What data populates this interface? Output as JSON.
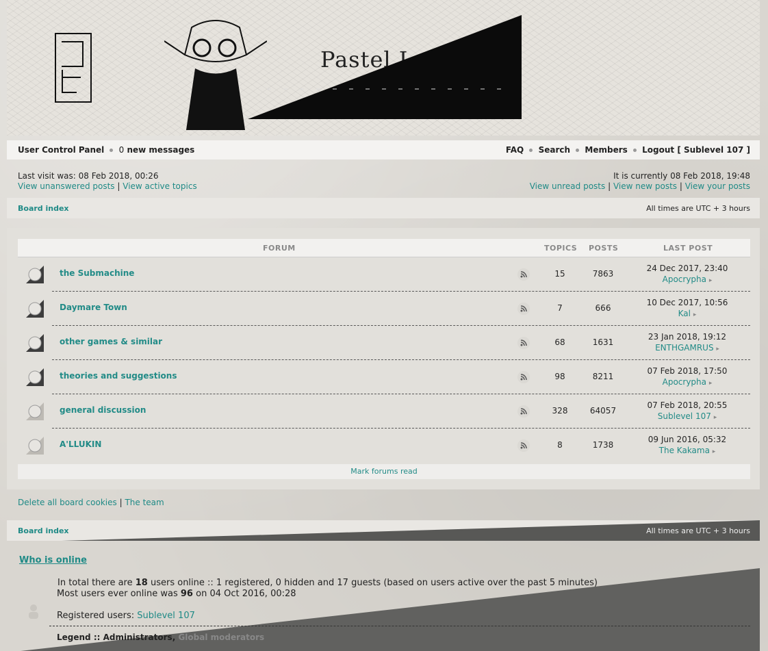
{
  "header": {
    "site_title": "Pastel Land F"
  },
  "navbar": {
    "ucp": "User Control Panel",
    "msg_count": "0",
    "new_messages": "new messages",
    "faq": "FAQ",
    "search": "Search",
    "members": "Members",
    "logout": "Logout [ Sublevel 107 ]"
  },
  "info": {
    "last_visit": "Last visit was: 08 Feb 2018, 00:26",
    "current_time": "It is currently 08 Feb 2018, 19:48",
    "view_unanswered": "View unanswered posts",
    "view_active": "View active topics",
    "view_unread": "View unread posts",
    "view_new": "View new posts",
    "view_your": "View your posts",
    "sep": "|"
  },
  "breadcrumb": {
    "board_index": "Board index",
    "timezone": "All times are UTC + 3 hours"
  },
  "forum_table": {
    "col_forum": "FORUM",
    "col_topics": "TOPICS",
    "col_posts": "POSTS",
    "col_last_post": "LAST POST",
    "rows": [
      {
        "name": "the Submachine",
        "topics": "15",
        "posts": "7863",
        "last_date": "24 Dec 2017, 23:40",
        "last_user": "Apocrypha"
      },
      {
        "name": "Daymare Town",
        "topics": "7",
        "posts": "666",
        "last_date": "10 Dec 2017, 10:56",
        "last_user": "Kal"
      },
      {
        "name": "other games & similar",
        "topics": "68",
        "posts": "1631",
        "last_date": "23 Jan 2018, 19:12",
        "last_user": "ENTHGAMRUS"
      },
      {
        "name": "theories and suggestions",
        "topics": "98",
        "posts": "8211",
        "last_date": "07 Feb 2018, 17:50",
        "last_user": "Apocrypha"
      },
      {
        "name": "general discussion",
        "topics": "328",
        "posts": "64057",
        "last_date": "07 Feb 2018, 20:55",
        "last_user": "Sublevel 107"
      },
      {
        "name": "A'LLUKIN",
        "topics": "8",
        "posts": "1738",
        "last_date": "09 Jun 2016, 05:32",
        "last_user": "The Kakama"
      }
    ],
    "mark_read": "Mark forums read"
  },
  "footer_links": {
    "delete_cookies": "Delete all board cookies",
    "sep": "|",
    "team": "The team"
  },
  "who_online": {
    "title": "Who is online",
    "line1_pre": "In total there are ",
    "total": "18",
    "line1_post": " users online :: 1 registered, 0 hidden and 17 guests (based on users active over the past 5 minutes)",
    "line2_pre": "Most users ever online was ",
    "max": "96",
    "line2_post": " on 04 Oct 2016, 00:28",
    "registered_label": "Registered users: ",
    "registered_user": "Sublevel 107",
    "legend_label": "Legend :: ",
    "legend_admins": "Administrators",
    "legend_mods": "Global moderators"
  }
}
